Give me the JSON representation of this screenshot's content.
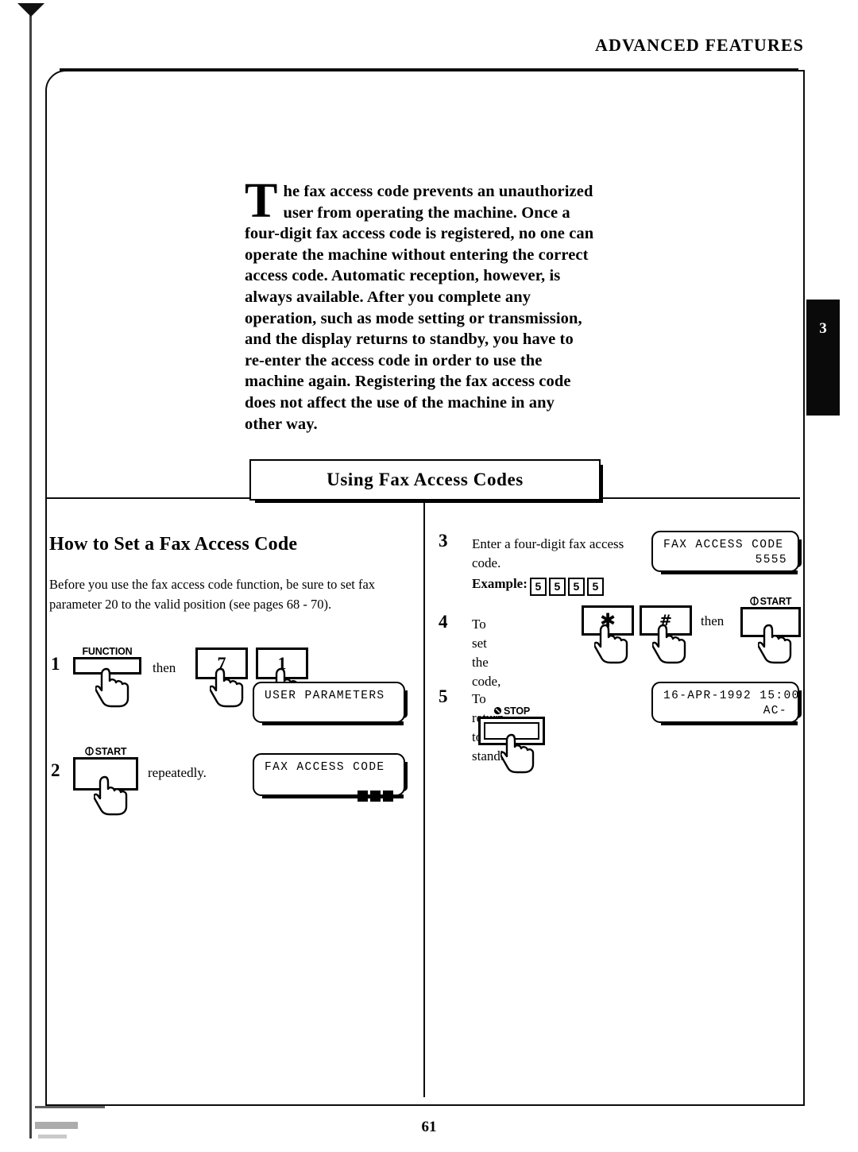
{
  "header": {
    "running_head": "ADVANCED FEATURES",
    "chapter_tab": "3"
  },
  "intro": {
    "dropcap": "T",
    "body": "he fax access code prevents an unauthorized user from operating the machine.  Once a four-digit fax access code is registered, no one can operate the machine without entering the correct access code.  Automatic reception, however, is always available.  After you complete any operation, such as mode setting or transmission, and the display returns to standby, you have to re-enter the access code in order to use the machine again.  Registering the fax access code does not affect the use of the machine in any other way."
  },
  "section": {
    "title": "Using Fax Access Codes"
  },
  "left_column": {
    "heading": "How to Set a Fax Access Code",
    "lead": "Before you use the fax access code function, be sure to set fax parameter 20 to the valid position (see pages 68 - 70).",
    "steps": [
      {
        "number": "1",
        "keys": [
          {
            "caption": "FUNCTION",
            "glyph": ""
          },
          {
            "caption": "",
            "glyph": "7"
          },
          {
            "caption": "",
            "glyph": "1"
          }
        ],
        "connector": "then",
        "display": {
          "line1": "USER PARAMETERS",
          "line2": ""
        }
      },
      {
        "number": "2",
        "key_caption": "START",
        "text": "repeatedly.",
        "display": {
          "line1": "FAX ACCESS CODE",
          "line2": "",
          "cursor_blocks": 3
        }
      }
    ]
  },
  "right_column": {
    "steps": [
      {
        "number": "3",
        "text_line1": "Enter a four-digit fax access",
        "text_line2": "code.",
        "example_label": "Example:",
        "example_digits": [
          "5",
          "5",
          "5",
          "5"
        ],
        "display": {
          "line1": "FAX ACCESS CODE",
          "line2": "5555"
        }
      },
      {
        "number": "4",
        "text": "To set the code,",
        "key1": "✱",
        "key2": "#",
        "connector": "then",
        "start_caption": "START"
      },
      {
        "number": "5",
        "text": "To return to standby,",
        "stop_caption": "STOP",
        "display": {
          "line1": "16-APR-1992 15:00",
          "line2": "AC-"
        }
      }
    ]
  },
  "footer": {
    "page_number": "61"
  }
}
